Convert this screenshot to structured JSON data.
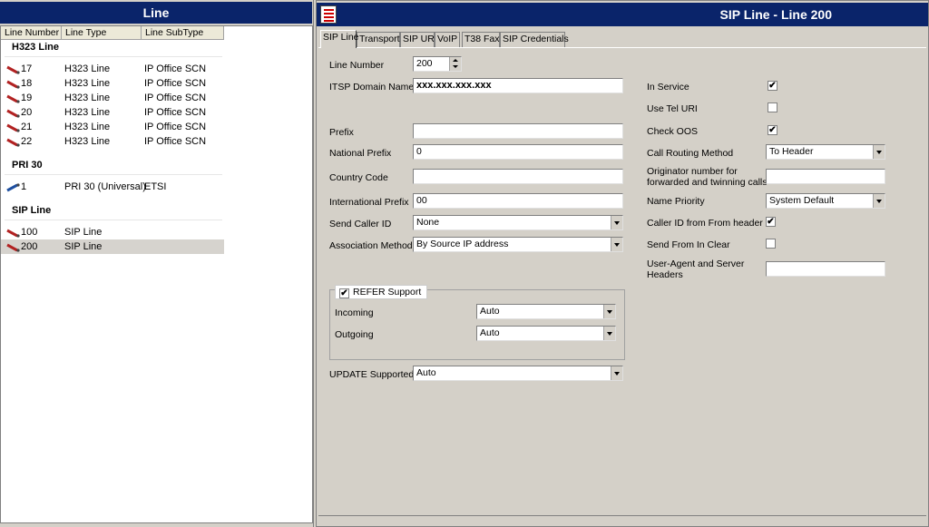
{
  "left_panel": {
    "title": "Line",
    "columns": [
      "Line Number",
      "Line Type",
      "Line SubType"
    ],
    "groups": [
      {
        "name": "H323 Line",
        "rows": [
          {
            "number": "17",
            "type": "H323 Line",
            "subtype": "IP Office SCN"
          },
          {
            "number": "18",
            "type": "H323 Line",
            "subtype": "IP Office SCN"
          },
          {
            "number": "19",
            "type": "H323 Line",
            "subtype": "IP Office SCN"
          },
          {
            "number": "20",
            "type": "H323 Line",
            "subtype": "IP Office SCN"
          },
          {
            "number": "21",
            "type": "H323 Line",
            "subtype": "IP Office SCN"
          },
          {
            "number": "22",
            "type": "H323 Line",
            "subtype": "IP Office SCN"
          }
        ]
      },
      {
        "name": "PRI 30",
        "rows": [
          {
            "number": "1",
            "type": "PRI 30 (Universal)",
            "subtype": "ETSI"
          }
        ]
      },
      {
        "name": "SIP Line",
        "rows": [
          {
            "number": "100",
            "type": "SIP Line",
            "subtype": ""
          },
          {
            "number": "200",
            "type": "SIP Line",
            "subtype": "",
            "selected": true
          }
        ]
      }
    ]
  },
  "right_panel": {
    "title": "SIP Line - Line 200",
    "tabs": [
      "SIP Line",
      "Transport",
      "SIP URI",
      "VoIP",
      "T38 Fax",
      "SIP Credentials"
    ],
    "active_tab": "SIP Line",
    "left_fields": {
      "line_number": {
        "label": "Line Number",
        "value": "200"
      },
      "itsp_domain": {
        "label": "ITSP Domain Name",
        "value": "xxx.xxx.xxx.xxx"
      },
      "prefix": {
        "label": "Prefix",
        "value": ""
      },
      "national_prefix": {
        "label": "National Prefix",
        "value": "0"
      },
      "country_code": {
        "label": "Country Code",
        "value": ""
      },
      "international_prefix": {
        "label": "International Prefix",
        "value": "00"
      },
      "send_caller_id": {
        "label": "Send Caller ID",
        "value": "None"
      },
      "association_method": {
        "label": "Association Method",
        "value": "By Source IP address"
      },
      "refer_support": {
        "label": "REFER Support",
        "checked": true
      },
      "incoming": {
        "label": "Incoming",
        "value": "Auto"
      },
      "outgoing": {
        "label": "Outgoing",
        "value": "Auto"
      },
      "update_supported": {
        "label": "UPDATE Supported",
        "value": "Auto"
      }
    },
    "right_fields": {
      "in_service": {
        "label": "In Service",
        "checked": true
      },
      "use_tel_uri": {
        "label": "Use Tel URI",
        "checked": false
      },
      "check_oos": {
        "label": "Check OOS",
        "checked": true
      },
      "call_routing_method": {
        "label": "Call Routing Method",
        "value": "To Header"
      },
      "originator_number": {
        "label_line1": "Originator number for",
        "label_line2": "forwarded and twinning calls",
        "value": ""
      },
      "name_priority": {
        "label": "Name Priority",
        "value": "System Default"
      },
      "caller_id_from_header": {
        "label": "Caller ID from From header",
        "checked": true
      },
      "send_from_in_clear": {
        "label": "Send From In Clear",
        "checked": false
      },
      "user_agent_headers": {
        "label_line1": "User-Agent and Server",
        "label_line2": "Headers",
        "value": ""
      }
    }
  },
  "colors": {
    "title_bar": "#0a246a",
    "panel_bg": "#d4d0c8",
    "selected_row": "#d6d3ce",
    "line_icon": "#b22222",
    "pri_icon": "#1e4fa0"
  },
  "icons": {
    "h323_row": "red-cable-icon",
    "pri_row": "blue-cable-icon",
    "sip_row": "red-cable-icon",
    "menu": "list-menu-icon",
    "checkmark": "✔"
  }
}
